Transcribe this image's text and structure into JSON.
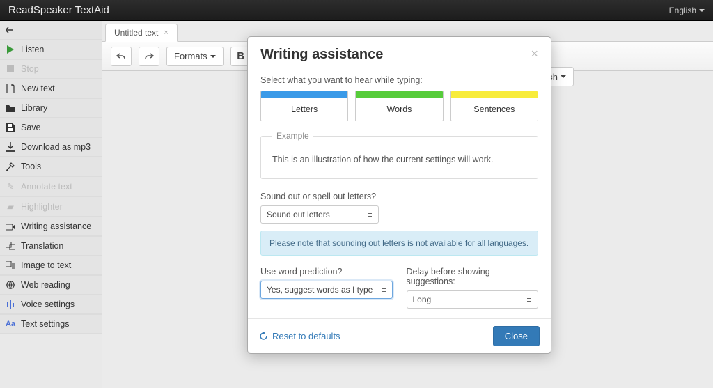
{
  "topbar": {
    "brand": "ReadSpeaker TextAid",
    "language": "English"
  },
  "sidebar": {
    "listen": "Listen",
    "stop": "Stop",
    "newText": "New text",
    "library": "Library",
    "save": "Save",
    "downloadMp3": "Download as mp3",
    "tools": "Tools",
    "annotate": "Annotate text",
    "highlighter": "Highlighter",
    "writingAssistance": "Writing assistance",
    "translation": "Translation",
    "imageToText": "Image to text",
    "webReading": "Web reading",
    "voiceSettings": "Voice settings",
    "textSettings": "Text settings"
  },
  "tabs": {
    "activeTitle": "Untitled text"
  },
  "toolbar": {
    "formats": "Formats",
    "bold": "B",
    "behindRight": "lish"
  },
  "modal": {
    "title": "Writing assistance",
    "intro": "Select what you want to hear while typing:",
    "seg": {
      "letters": "Letters",
      "words": "Words",
      "sentences": "Sentences"
    },
    "exampleLegend": "Example",
    "exampleText": "This is an illustration of how the current settings will work.",
    "soundOutLabel": "Sound out or spell out letters?",
    "soundOutValue": "Sound out letters",
    "notice": "Please note that sounding out letters is not available for all languages.",
    "wordPredLabel": "Use word prediction?",
    "wordPredValue": "Yes, suggest words as I type",
    "delayLabel": "Delay before showing suggestions:",
    "delayValue": "Long",
    "reset": "Reset to defaults",
    "close": "Close"
  }
}
